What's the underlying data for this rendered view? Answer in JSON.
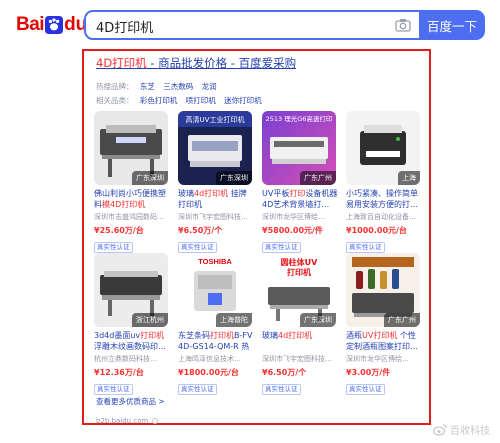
{
  "header": {
    "logo_text_1": "Bai",
    "logo_text_2": "du",
    "logo_text_cn": "百度",
    "search_value": "4D打印机",
    "search_button": "百度一下"
  },
  "result": {
    "title_prefix": "4D打印机",
    "title_suffix": " - 商品批发价格 - 百度爱采购",
    "hot_brands_label": "热搜品牌：",
    "hot_brands": [
      "东芝",
      "三杰数码",
      "龙润"
    ],
    "related_label": "相关品类：",
    "related": [
      "彩色打印机",
      "喷打印机",
      "迷你打印机"
    ],
    "more_link": "查看更多优质商品 >",
    "source": "b2b.baidu.com",
    "items": [
      {
        "location": "广东深圳",
        "title_a": "佛山利尚小巧便携塑料",
        "title_em": "模4D打印机",
        "title_b": "",
        "company": "深圳市志盛鸿园数码…",
        "price": "¥25.60万/台",
        "badge": "真实性认证"
      },
      {
        "location": "广东深圳",
        "title_a": "玻璃",
        "title_em": "4d打印机",
        "title_b": " 挂牌打印机",
        "company": "深圳市飞宇宏图科技…",
        "price": "¥6.50万/个",
        "badge": "真实性认证"
      },
      {
        "location": "广东广州",
        "title_a": "UV平板",
        "title_em": "打印",
        "title_b": "设备机器4D艺术背景墙打…",
        "company": "深圳市龙华区博绘…",
        "price": "¥5800.00元/件",
        "badge": "真实性认证"
      },
      {
        "location": "上海",
        "title_a": "小巧紧凑、操作简单易用",
        "title_em": "",
        "title_b": "安装方便的打…",
        "company": "上海致百自动化设备…",
        "price": "¥1000.00元/台",
        "badge": "真实性认证"
      },
      {
        "location": "浙江杭州",
        "title_a": "3d4d墨面uv",
        "title_em": "打印机",
        "title_b": "浮雕木纹画数码印…",
        "company": "杭州立鼎数码科技…",
        "price": "¥12.36万/台",
        "badge": "真实性认证"
      },
      {
        "location": "上海普陀",
        "title_a": "东芝条码",
        "title_em": "打印机",
        "title_b": "B-FV4D-GS14-QM-R 热敏…",
        "company": "上海鸣泽信息技术…",
        "price": "¥1800.00元/台",
        "badge": "真实性认证"
      },
      {
        "location": "广东深圳",
        "title_a": "玻璃",
        "title_em": "4d打印机",
        "title_b": "",
        "company": "深圳市飞宇宏图科技…",
        "price": "¥6.50万/个",
        "badge": "真实性认证"
      },
      {
        "location": "广东广州",
        "title_a": "酒瓶",
        "title_em": "UV打印机",
        "title_b": " 个性定制酒瓶图案打印…",
        "company": "深圳市龙华区博绘…",
        "price": "¥3.00万/件",
        "badge": "真实性认证"
      }
    ]
  },
  "thumbs": {
    "t2_caption": "高清UV工业打印机",
    "t3_caption": "2513 理光G6高速打印",
    "t6_brand": "TOSHIBA",
    "t7_text_1": "圆柱体UV",
    "t7_text_2": "打印机"
  },
  "watermark": "百收科技",
  "colors": {
    "brand_red": "#e10602",
    "accent_blue": "#4e6ef2",
    "link_blue": "#2440b3",
    "price_red": "#f73131",
    "highlight_border": "#e31d1d"
  }
}
